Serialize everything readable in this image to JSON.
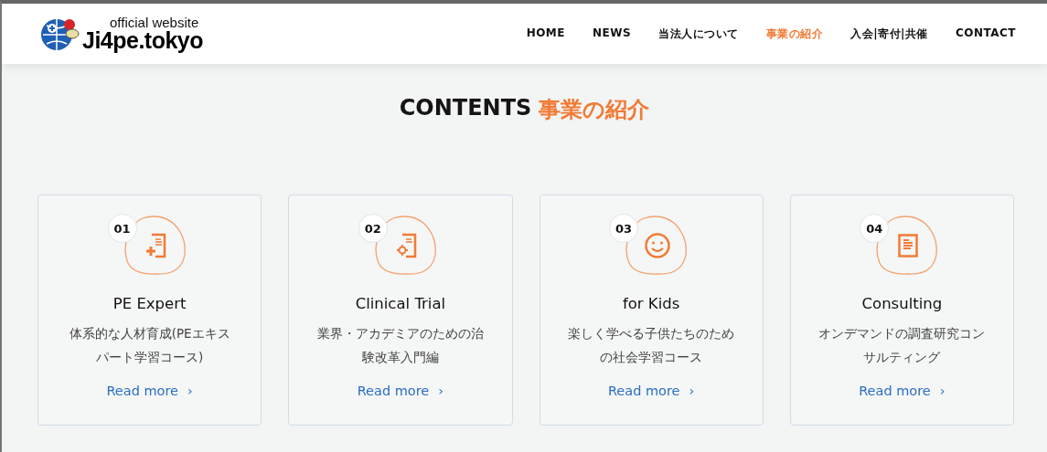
{
  "header": {
    "logo": {
      "tagline": "official website",
      "name": "Ji4pe.tokyo"
    },
    "nav": [
      {
        "label": "HOME",
        "selected": false
      },
      {
        "label": "NEWS",
        "selected": false
      },
      {
        "label": "当法人について",
        "selected": false
      },
      {
        "label": "事業の紹介",
        "selected": true
      },
      {
        "label": "入会|寄付|共催",
        "selected": false
      },
      {
        "label": "CONTACT",
        "selected": false
      }
    ]
  },
  "section": {
    "title": "CONTENTS",
    "title_accent": "事業の紹介",
    "cards": [
      {
        "number": "01",
        "kind": "doc-plus",
        "title": "PE Expert",
        "description": [
          "体系的な人材育成(PEエキス",
          "パート学習コース)"
        ],
        "link": "Read more",
        "chevron": "›"
      },
      {
        "number": "02",
        "kind": "doc-gear",
        "title": "Clinical Trial",
        "description": [
          "業界・アカデミアのための治",
          "験改革入門編"
        ],
        "link": "Read more",
        "chevron": "›"
      },
      {
        "number": "03",
        "kind": "smiley",
        "title": "for Kids",
        "description": [
          "楽しく学べる子供たちのため",
          "の社会学習コース"
        ],
        "link": "Read more",
        "chevron": "›"
      },
      {
        "number": "04",
        "kind": "document",
        "title": "Consulting",
        "description": [
          "オンデマンドの調査研究コン",
          "サルティング"
        ],
        "link": "Read more",
        "chevron": "›"
      }
    ]
  }
}
